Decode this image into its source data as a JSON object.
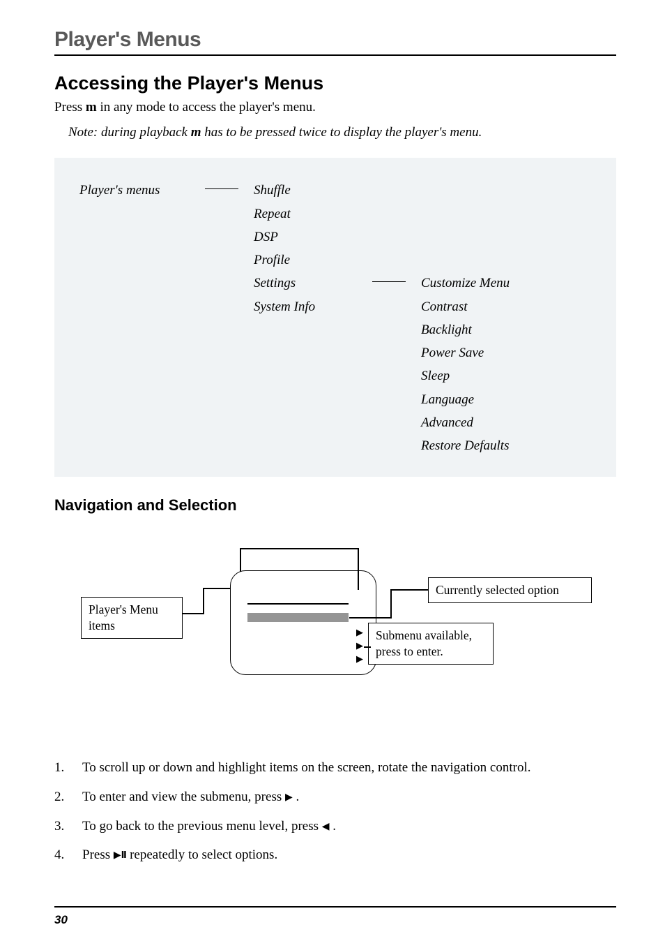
{
  "chapter_title": "Player's Menus",
  "section_title": "Accessing the Player's Menus",
  "intro": {
    "pre": "Press ",
    "key": "m",
    "post": " in any mode to access the player's menu."
  },
  "note": {
    "pre": "Note: during playback ",
    "key": "m",
    "post": " has to be pressed twice to display the player's menu."
  },
  "menu_tree": {
    "root_label": "Player's menus",
    "level1": [
      "Shuffle",
      "Repeat",
      "DSP",
      "Profile",
      "Settings",
      "System Info"
    ],
    "level2_parent_index": 4,
    "level2": [
      "Customize Menu",
      "Contrast",
      "Backlight",
      "Power Save",
      "Sleep",
      "Language",
      "Advanced",
      "Restore Defaults"
    ]
  },
  "subsection_title": "Navigation and Selection",
  "nav_diagram": {
    "box_left": "Player's Menu items",
    "box_top_right": "Currently selected option",
    "box_bottom_right": "Submenu available, press to enter."
  },
  "steps": [
    "To scroll up or down and highlight items on the screen, rotate the navigation control.",
    "To enter and view the submenu, press ▶ .",
    "To go back to the previous menu level, press ◀ .",
    "Press ▶❙❙ repeatedly to select options."
  ],
  "steps_plain": {
    "s1": "To scroll up or down and highlight items on the screen, rotate the navigation control.",
    "s2_pre": "To enter and view the submenu, press ",
    "s2_post": " .",
    "s3_pre": "To go back to the previous menu level, press ",
    "s3_post": " .",
    "s4_pre": "Press ",
    "s4_post": "  repeatedly to select options."
  },
  "page_number": "30"
}
